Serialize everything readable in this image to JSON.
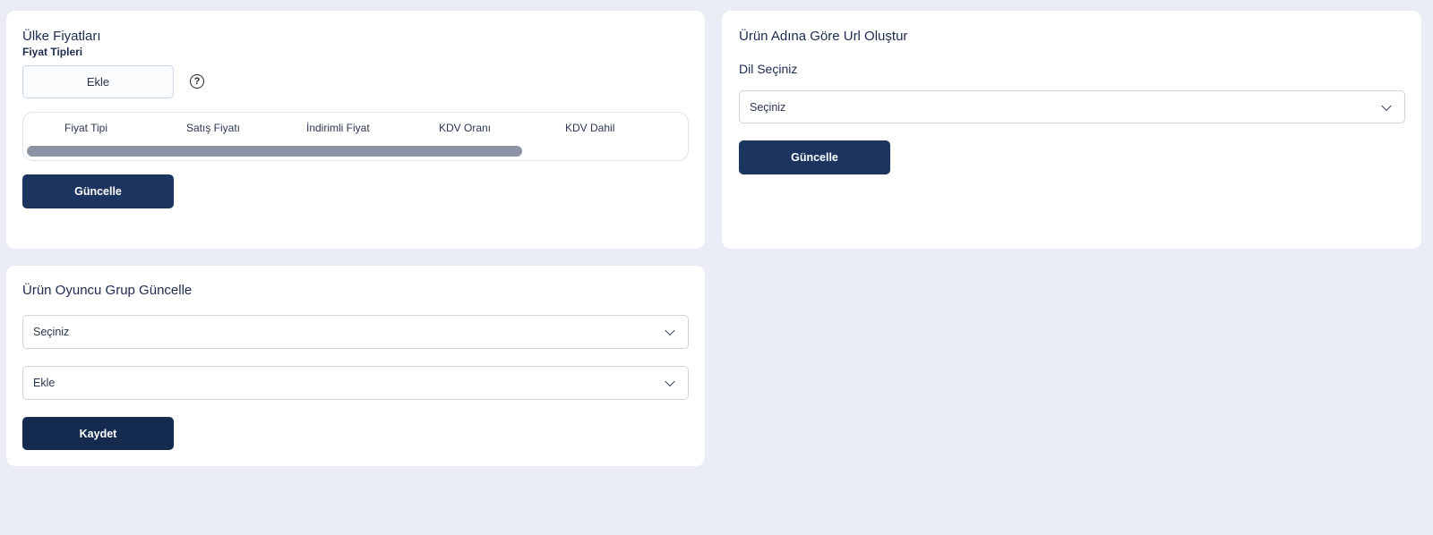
{
  "country_prices": {
    "title": "Ülke Fiyatları",
    "subtitle": "Fiyat Tipleri",
    "add_button": "Ekle",
    "help_icon": "question-circle-icon",
    "help_glyph": "?",
    "columns": [
      "Fiyat Tipi",
      "Satış Fiyatı",
      "İndirimli Fiyat",
      "KDV Oranı",
      "KDV Dahil"
    ],
    "update_button": "Güncelle"
  },
  "url_by_name": {
    "title": "Ürün Adına Göre Url Oluştur",
    "language_label": "Dil Seçiniz",
    "language_select": {
      "value": "Seçiniz"
    },
    "update_button": "Güncelle"
  },
  "player_group": {
    "title": "Ürün Oyuncu Grup Güncelle",
    "group_select": {
      "value": "Seçiniz"
    },
    "add_select": {
      "value": "Ekle"
    },
    "save_button": "Kaydet"
  },
  "colors": {
    "page_bg": "#eaedf5",
    "card_bg": "#ffffff",
    "primary": "#1b3460",
    "primary_dark": "#152a4f",
    "scrollbar": "#8b93a4"
  }
}
